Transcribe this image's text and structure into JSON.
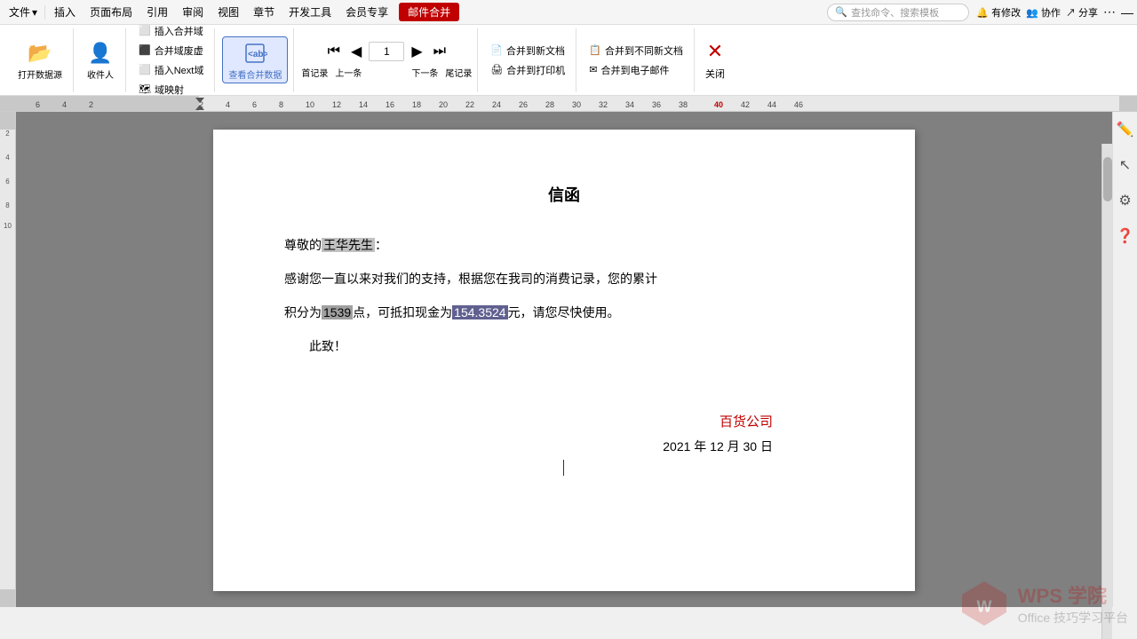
{
  "menubar": {
    "items": [
      "文件",
      "插入",
      "页面布局",
      "引用",
      "审阅",
      "视图",
      "章节",
      "开发工具",
      "会员专享"
    ],
    "mail_merge_btn": "邮件合并",
    "search_placeholder": "查找命令、搜索模板",
    "top_right": [
      "有修改",
      "协作",
      "分享"
    ]
  },
  "ribbon": {
    "groups": [
      {
        "label": "打开数据源",
        "icon": "📂",
        "sublabel": "打开数据源"
      },
      {
        "label": "收件人",
        "icon": "👤",
        "sublabel": "收件人"
      }
    ],
    "insert_group": {
      "label": "插入Next域",
      "items": [
        "插入合并域",
        "合并域废虚",
        "插入Next域",
        "域映射"
      ]
    },
    "view_btn": {
      "label": "查看合并数据",
      "icon": "📋"
    },
    "nav_group": {
      "first": "首记录",
      "prev": "上一条",
      "page_num": "1",
      "next": "下一条",
      "last": "尾记录"
    },
    "merge_actions": {
      "to_new_doc": "合并到新文档",
      "to_print": "合并到打印机",
      "to_diff_doc": "合并到不同新文档",
      "to_email": "合并到电子邮件",
      "close": "关闭"
    }
  },
  "ruler": {
    "marks": [
      "-6",
      "-4",
      "-2",
      "2",
      "4",
      "6",
      "8",
      "10",
      "12",
      "14",
      "16",
      "18",
      "20",
      "22",
      "24",
      "26",
      "28",
      "30",
      "32",
      "34",
      "36",
      "38",
      "40",
      "42",
      "44",
      "46"
    ]
  },
  "document": {
    "title": "信函",
    "greeting": "尊敬的",
    "name_highlight": "王华先生",
    "greeting_end": "：",
    "body1": "感谢您一直以来对我们的支持，根据您在我司的消费记录，您的累计",
    "body2": "积分为",
    "points": "1539",
    "body2_mid": "点，可抵扣现金为",
    "amount": "154.3524",
    "body2_end": "元，请您尽快使用。",
    "closing": "此致！",
    "company": "百货公司",
    "date": "2021 年 12 月 30 日"
  },
  "wps": {
    "label": "WPS 学院",
    "sublabel": "Office 技巧学习平台"
  }
}
